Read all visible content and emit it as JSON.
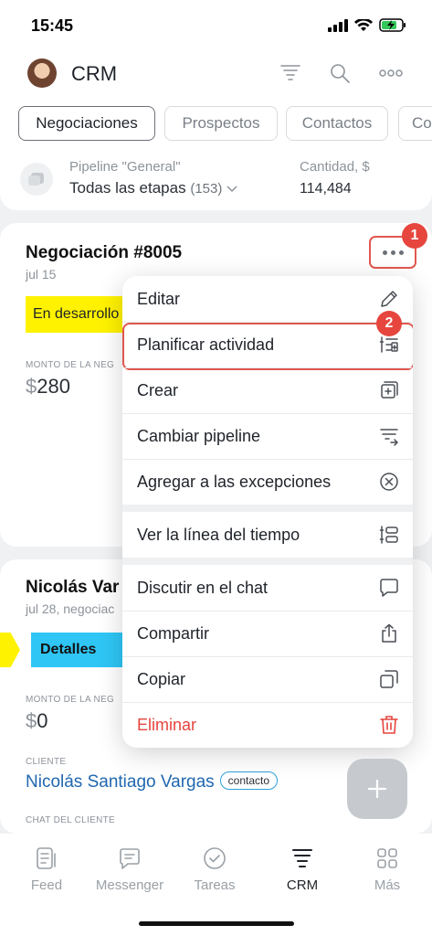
{
  "status": {
    "time": "15:45"
  },
  "header": {
    "title": "CRM"
  },
  "tabs": [
    "Negociaciones",
    "Prospectos",
    "Contactos",
    "Co"
  ],
  "pipeline": {
    "label": "Pipeline \"General\"",
    "stages": "Todas las etapas",
    "count": "(153)",
    "amount_label": "Cantidad, $",
    "amount_value": "114,484"
  },
  "deal1": {
    "title": "Negociación #8005",
    "date": "jul 15",
    "stage": "En desarrollo",
    "amount_label": "MONTO DE LA NEG",
    "currency": "$",
    "amount": "280"
  },
  "deal2": {
    "title": "Nicolás Var",
    "date": "jul 28, negociac",
    "stage": "Detalles",
    "amount_label": "MONTO DE LA NEG",
    "currency": "$",
    "amount": "0",
    "client_label": "CLIENTE",
    "client_name": "Nicolás Santiago Vargas",
    "client_tag": "contacto",
    "chat_label": "CHAT DEL CLIENTE"
  },
  "badges": {
    "one": "1",
    "two": "2"
  },
  "menu": {
    "items": [
      {
        "label": "Editar",
        "icon": "pencil-icon"
      },
      {
        "label": "Planificar actividad",
        "icon": "plan-activity-icon"
      },
      {
        "label": "Crear",
        "icon": "add-copy-icon"
      },
      {
        "label": "Cambiar pipeline",
        "icon": "change-pipeline-icon"
      },
      {
        "label": "Agregar a las excepciones",
        "icon": "circle-x-icon"
      },
      {
        "label": "Ver la línea del tiempo",
        "icon": "timeline-icon"
      },
      {
        "label": "Discutir en el chat",
        "icon": "chat-icon"
      },
      {
        "label": "Compartir",
        "icon": "share-icon"
      },
      {
        "label": "Copiar",
        "icon": "copy-icon"
      },
      {
        "label": "Eliminar",
        "icon": "trash-icon"
      }
    ]
  },
  "nav": [
    {
      "label": "Feed",
      "icon": "feed-icon"
    },
    {
      "label": "Messenger",
      "icon": "messenger-icon"
    },
    {
      "label": "Tareas",
      "icon": "tasks-icon"
    },
    {
      "label": "CRM",
      "icon": "crm-icon"
    },
    {
      "label": "Más",
      "icon": "more-grid-icon"
    }
  ],
  "colors": {
    "accent_blue": "#2fc6f6",
    "stage_yellow": "#fff200",
    "danger": "#e5453d",
    "link": "#2067b0",
    "highlight": "#e0574f"
  }
}
